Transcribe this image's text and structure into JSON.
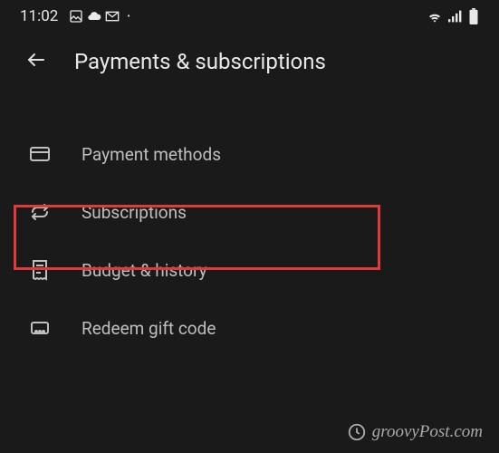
{
  "status_bar": {
    "time": "11:02"
  },
  "header": {
    "title": "Payments & subscriptions"
  },
  "menu": {
    "items": [
      {
        "label": "Payment methods"
      },
      {
        "label": "Subscriptions"
      },
      {
        "label": "Budget & history"
      },
      {
        "label": "Redeem gift code"
      }
    ]
  },
  "watermark": {
    "text": "groovyPost.com"
  }
}
